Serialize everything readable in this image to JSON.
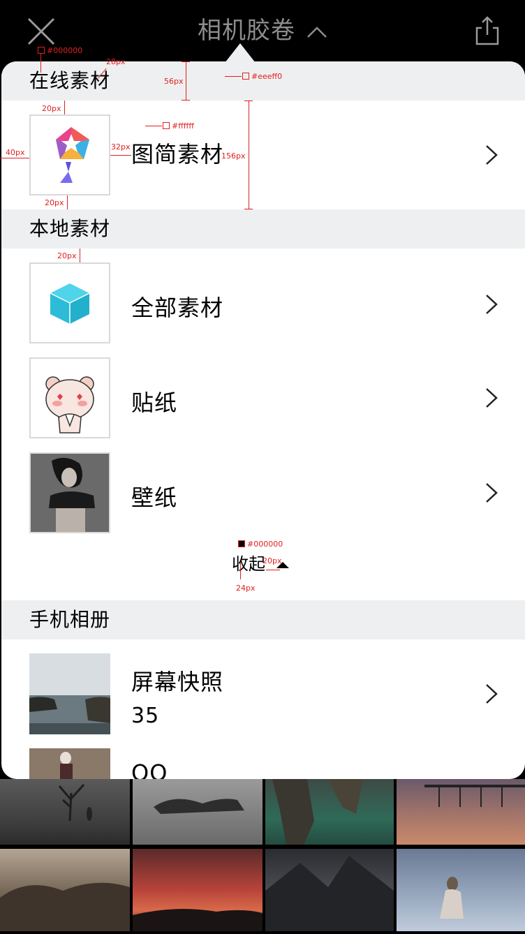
{
  "header": {
    "title": "相机胶卷"
  },
  "sections": {
    "online": "在线素材",
    "local": "本地素材",
    "phone_album": "手机相册"
  },
  "rows": {
    "tujian": "图简素材",
    "all": "全部素材",
    "stickers": "贴纸",
    "wallpaper": "壁纸",
    "screenshot": "屏幕快照",
    "screenshot_count": "35",
    "qq": "QQ"
  },
  "collapse_label": "收起",
  "annotations": {
    "c1": "#000000",
    "s28": "28px",
    "s56": "56px",
    "c2": "#eeeff0",
    "s20a": "20px",
    "c3": "#ffffff",
    "s32": "32px",
    "s40": "40px",
    "s156": "156px",
    "s20b": "20px",
    "s20c": "20px",
    "c4": "#000000",
    "s20d": "20px",
    "s24": "24px"
  },
  "colors": {
    "section_bg": "#eeeff0",
    "panel_bg": "#ffffff",
    "topbar_bg": "#000000",
    "annotation": "#e02020"
  }
}
